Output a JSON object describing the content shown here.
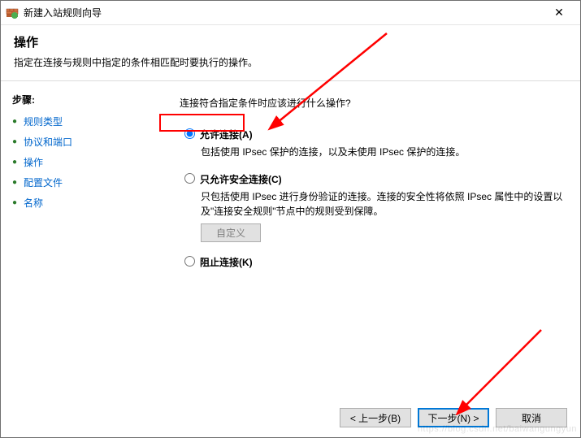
{
  "window": {
    "title": "新建入站规则向导",
    "close_label": "✕"
  },
  "header": {
    "title": "操作",
    "subtitle": "指定在连接与规则中指定的条件相匹配时要执行的操作。"
  },
  "sidebar": {
    "steps_label": "步骤:",
    "items": [
      {
        "label": "规则类型"
      },
      {
        "label": "协议和端口"
      },
      {
        "label": "操作"
      },
      {
        "label": "配置文件"
      },
      {
        "label": "名称"
      }
    ]
  },
  "content": {
    "prompt": "连接符合指定条件时应该进行什么操作?",
    "options": {
      "allow": {
        "label": "允许连接(A)",
        "desc": "包括使用 IPsec 保护的连接，以及未使用 IPsec 保护的连接。"
      },
      "secure": {
        "label": "只允许安全连接(C)",
        "desc": "只包括使用 IPsec 进行身份验证的连接。连接的安全性将依照 IPsec 属性中的设置以及\"连接安全规则\"节点中的规则受到保障。",
        "customize_label": "自定义"
      },
      "block": {
        "label": "阻止连接(K)"
      }
    },
    "selected": "allow"
  },
  "buttons": {
    "back": "< 上一步(B)",
    "next": "下一步(N) >",
    "cancel": "取消"
  },
  "watermark": "https://blog.csdn.net/baiwangungyun"
}
